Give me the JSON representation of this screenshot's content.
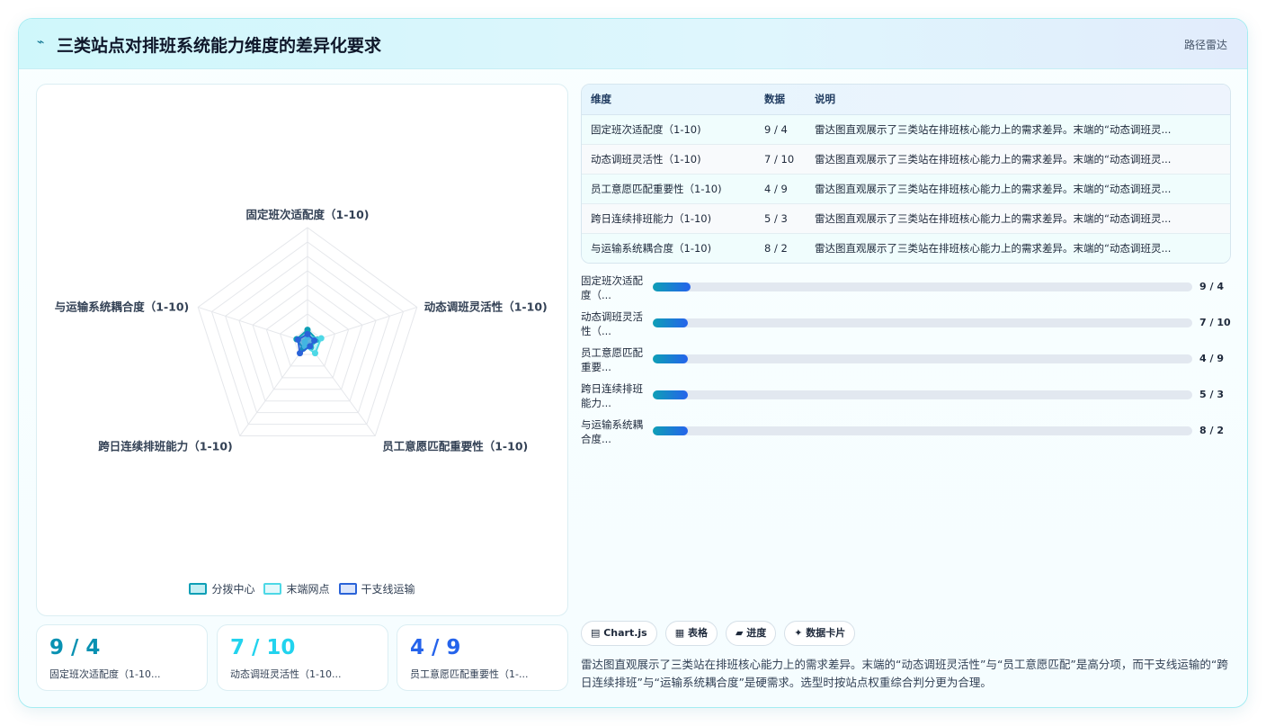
{
  "header": {
    "icon": "⌁",
    "title": "三类站点对排班系统能力维度的差异化要求",
    "tag": "路径雷达"
  },
  "colors": {
    "hub": "#0e9fb6",
    "terminal": "#4dd8e6",
    "trunk": "#2a63d8",
    "hub_fill": "#0e9fb6",
    "accent_stat1": "#0891b2",
    "accent_stat2": "#22d3ee",
    "accent_stat3": "#2563eb"
  },
  "chart_data": {
    "type": "radar",
    "axes": [
      "固定班次适配度（1-10)",
      "动态调班灵活性（1-10)",
      "员工意愿匹配重要性（1-10)",
      "跨日连续排班能力（1-10)",
      "与运输系统耦合度（1-10)"
    ],
    "rmax": 80,
    "series": [
      {
        "name": "分拨中心",
        "values": [
          9,
          7,
          4,
          5,
          8
        ]
      },
      {
        "name": "末端网点",
        "values": [
          4,
          10,
          9,
          3,
          2
        ]
      },
      {
        "name": "干支线运输",
        "values": [
          6,
          5,
          3,
          9,
          7
        ]
      }
    ],
    "legend": "bottom"
  },
  "stats": [
    {
      "value": "9 / 4",
      "label": "固定班次适配度（1-10..."
    },
    {
      "value": "7 / 10",
      "label": "动态调班灵活性（1-10..."
    },
    {
      "value": "4 / 9",
      "label": "员工意愿匹配重要性（1-..."
    }
  ],
  "table": {
    "headers": [
      "维度",
      "数据",
      "说明"
    ],
    "rows": [
      [
        "固定班次适配度（1-10)",
        "9 / 4",
        "雷达图直观展示了三类站在排班核心能力上的需求差异。末端的“动态调班灵..."
      ],
      [
        "动态调班灵活性（1-10)",
        "7 / 10",
        "雷达图直观展示了三类站在排班核心能力上的需求差异。末端的“动态调班灵..."
      ],
      [
        "员工意愿匹配重要性（1-10)",
        "4 / 9",
        "雷达图直观展示了三类站在排班核心能力上的需求差异。末端的“动态调班灵..."
      ],
      [
        "跨日连续排班能力（1-10)",
        "5 / 3",
        "雷达图直观展示了三类站在排班核心能力上的需求差异。末端的“动态调班灵..."
      ],
      [
        "与运输系统耦合度（1-10)",
        "8 / 2",
        "雷达图直观展示了三类站在排班核心能力上的需求差异。末端的“动态调班灵..."
      ]
    ]
  },
  "bars": [
    {
      "label": "固定班次适配度（...",
      "value": "9 / 4",
      "fraction": 0.07
    },
    {
      "label": "动态调班灵活性（...",
      "value": "7 / 10",
      "fraction": 0.065
    },
    {
      "label": "员工意愿匹配重要...",
      "value": "4 / 9",
      "fraction": 0.065
    },
    {
      "label": "跨日连续排班能力...",
      "value": "5 / 3",
      "fraction": 0.065
    },
    {
      "label": "与运输系统耦合度...",
      "value": "8 / 2",
      "fraction": 0.065
    }
  ],
  "chips": [
    "▤ Chart.js",
    "▦ 表格",
    "▰ 进度",
    "✦ 数据卡片"
  ],
  "note": "雷达图直观展示了三类站在排班核心能力上的需求差异。末端的“动态调班灵活性”与“员工意愿匹配”是高分项，而干支线运输的“跨日连续排班”与“运输系统耦合度”是硬需求。选型时按站点权重综合判分更为合理。"
}
